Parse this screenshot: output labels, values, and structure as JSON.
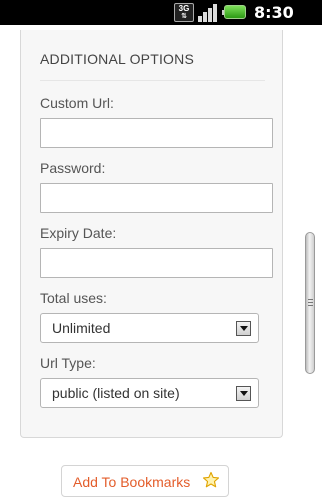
{
  "status_bar": {
    "network_label": "3G",
    "network_arrows": "⇅",
    "time": "8:30 PM"
  },
  "form": {
    "section_title": "ADDITIONAL OPTIONS",
    "custom_url": {
      "label": "Custom Url:",
      "value": ""
    },
    "password": {
      "label": "Password:",
      "value": ""
    },
    "expiry_date": {
      "label": "Expiry Date:",
      "value": ""
    },
    "total_uses": {
      "label": "Total uses:",
      "selected": "Unlimited"
    },
    "url_type": {
      "label": "Url Type:",
      "selected": "public (listed on site)"
    }
  },
  "bookmark": {
    "label": "Add To Bookmarks",
    "icon": "star-icon",
    "accent_color": "#e35d2b"
  }
}
